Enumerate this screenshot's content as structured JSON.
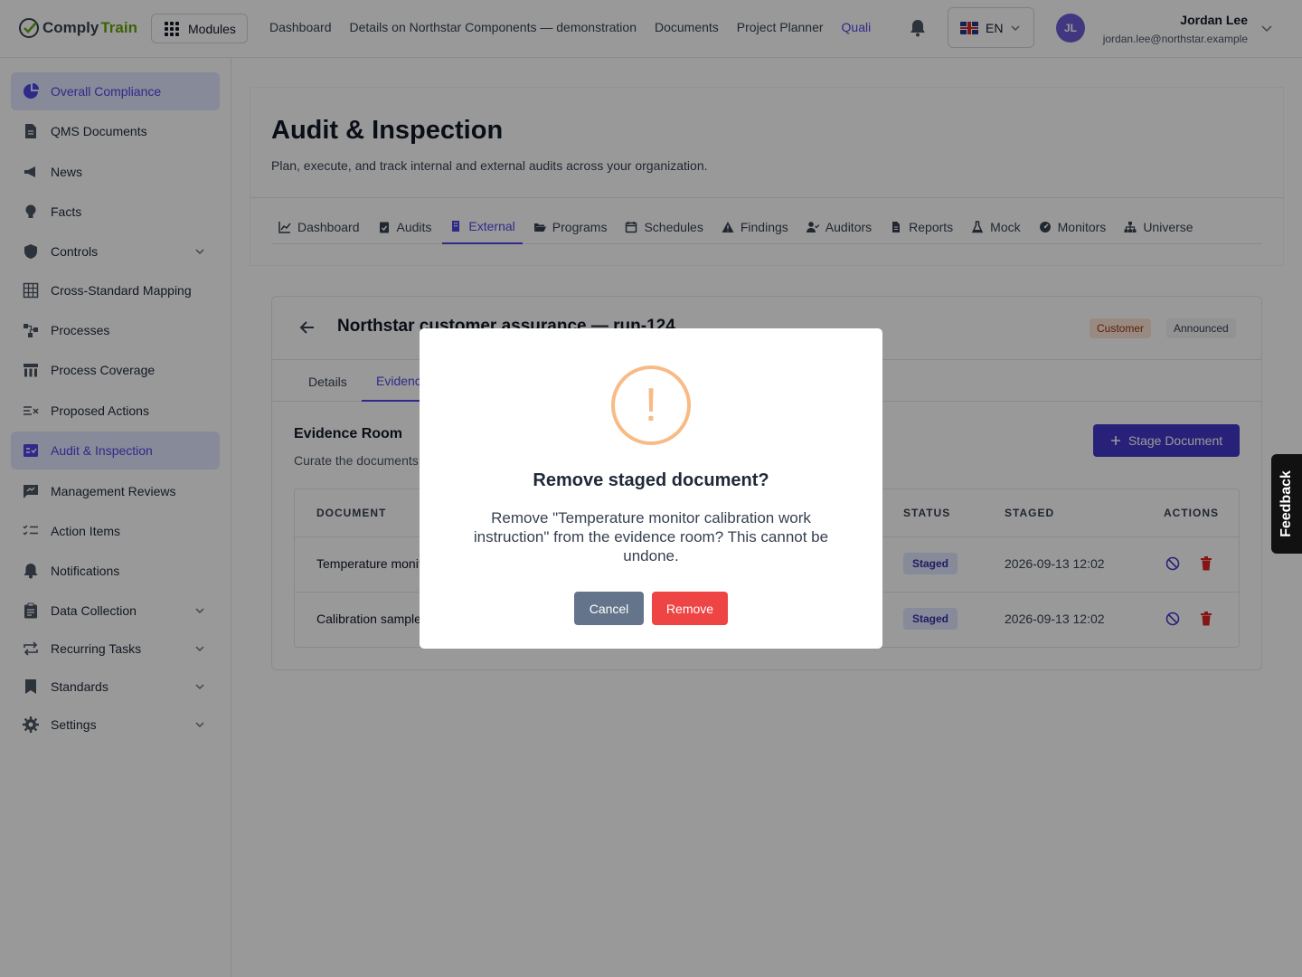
{
  "app": {
    "logo_part1": "Comply",
    "logo_part2": "Train"
  },
  "topbar": {
    "modules_label": "Modules",
    "nav": [
      "Dashboard",
      "Details on Northstar Components — demonstration",
      "Documents",
      "Project Planner",
      "Quali"
    ],
    "language": "EN",
    "user_initials": "JL",
    "user_name": "Jordan Lee",
    "user_email": "jordan.lee@northstar.example"
  },
  "sidebar": {
    "items": [
      {
        "label": "Overall Compliance",
        "icon": "pie-chart-icon",
        "active": true
      },
      {
        "label": "QMS Documents",
        "icon": "document-icon"
      },
      {
        "label": "News",
        "icon": "megaphone-icon"
      },
      {
        "label": "Facts",
        "icon": "lightbulb-icon"
      },
      {
        "label": "Controls",
        "icon": "shield-icon",
        "expandable": true
      },
      {
        "label": "Cross-Standard Mapping",
        "icon": "table-icon"
      },
      {
        "label": "Processes",
        "icon": "flow-icon"
      },
      {
        "label": "Process Coverage",
        "icon": "coverage-icon"
      },
      {
        "label": "Proposed Actions",
        "icon": "list-x-icon"
      },
      {
        "label": "Audit & Inspection",
        "icon": "audit-icon",
        "active": true
      },
      {
        "label": "Management Reviews",
        "icon": "review-icon"
      },
      {
        "label": "Action Items",
        "icon": "checklist-icon"
      },
      {
        "label": "Notifications",
        "icon": "bell-icon"
      },
      {
        "label": "Data Collection",
        "icon": "clipboard-icon",
        "expandable": true
      },
      {
        "label": "Recurring Tasks",
        "icon": "repeat-icon",
        "expandable": true
      },
      {
        "label": "Standards",
        "icon": "bookmark-icon",
        "expandable": true
      },
      {
        "label": "Settings",
        "icon": "gear-icon",
        "expandable": true
      }
    ]
  },
  "page": {
    "title": "Audit & Inspection",
    "subtitle": "Plan, execute, and track internal and external audits across your organization.",
    "tabs": [
      "Dashboard",
      "Audits",
      "External",
      "Programs",
      "Schedules",
      "Findings",
      "Auditors",
      "Reports",
      "Mock",
      "Monitors",
      "Universe"
    ],
    "active_tab": "External"
  },
  "detail": {
    "title": "Northstar customer assurance — run-124",
    "badge_type": "Customer",
    "badge_status": "Announced",
    "subtabs": [
      "Details",
      "Evidence"
    ],
    "evidence_title": "Evidence Room",
    "evidence_sub": "Curate the documents",
    "stage_button": "Stage Document",
    "columns": [
      "DOCUMENT",
      "STATUS",
      "STAGED",
      "ACTIONS"
    ],
    "rows": [
      {
        "document": "Temperature monitor calibration work instruction",
        "status": "Staged",
        "staged": "2026-09-13 12:02"
      },
      {
        "document": "Calibration sample",
        "status": "Staged",
        "staged": "2026-09-13 12:02"
      }
    ]
  },
  "feedback_label": "Feedback",
  "modal": {
    "icon": "!",
    "title": "Remove staged document?",
    "text": "Remove \"Temperature monitor calibration work instruction\" from the evidence room? This cannot be undone.",
    "cancel_label": "Cancel",
    "remove_label": "Remove"
  },
  "colors": {
    "accent": "#4f46e5",
    "danger": "#ef4444",
    "warning": "#f8bb86",
    "brand_green": "#65a30d"
  }
}
